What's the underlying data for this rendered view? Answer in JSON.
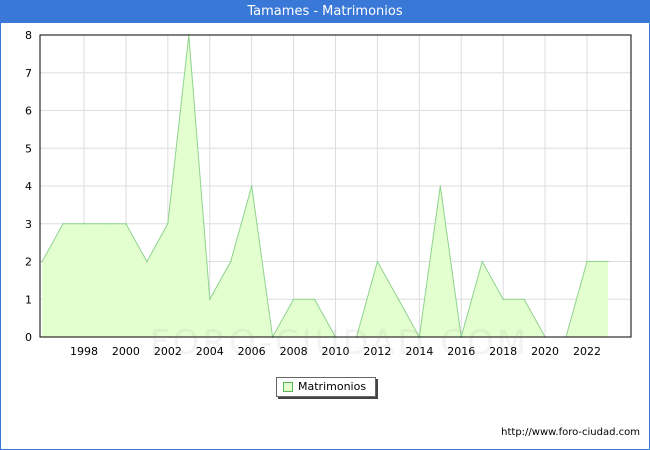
{
  "window": {
    "title": "Tamames - Matrimonios"
  },
  "footer": {
    "url": "http://www.foro-ciudad.com"
  },
  "watermark": {
    "text": "FORO-CIUDAD.COM"
  },
  "legend": {
    "label": "Matrimonios"
  },
  "colors": {
    "title_bar": "#3a78d8",
    "area_fill": "#e3ffcf",
    "area_line": "#8fd38f",
    "grid": "#dddddd"
  },
  "chart_data": {
    "type": "area",
    "title": "Tamames - Matrimonios",
    "xlabel": "",
    "ylabel": "",
    "x": [
      1996,
      1997,
      1998,
      1999,
      2000,
      2001,
      2002,
      2003,
      2004,
      2005,
      2006,
      2007,
      2008,
      2009,
      2010,
      2011,
      2012,
      2013,
      2014,
      2015,
      2016,
      2017,
      2018,
      2019,
      2020,
      2021,
      2022,
      2023
    ],
    "series": [
      {
        "name": "Matrimonios",
        "values": [
          2,
          3,
          3,
          3,
          3,
          2,
          3,
          8,
          1,
          2,
          4,
          0,
          1,
          1,
          0,
          0,
          2,
          1,
          0,
          4,
          0,
          2,
          1,
          1,
          0,
          0,
          2,
          2
        ]
      }
    ],
    "xticks": [
      "1998",
      "2000",
      "2002",
      "2004",
      "2006",
      "2008",
      "2010",
      "2012",
      "2014",
      "2016",
      "2018",
      "2020",
      "2022"
    ],
    "yticks": [
      "0",
      "1",
      "2",
      "3",
      "4",
      "5",
      "6",
      "7",
      "8"
    ],
    "xlim": [
      1996,
      2023
    ],
    "ylim": [
      0,
      8
    ],
    "grid": true,
    "legend_position": "bottom-center"
  }
}
